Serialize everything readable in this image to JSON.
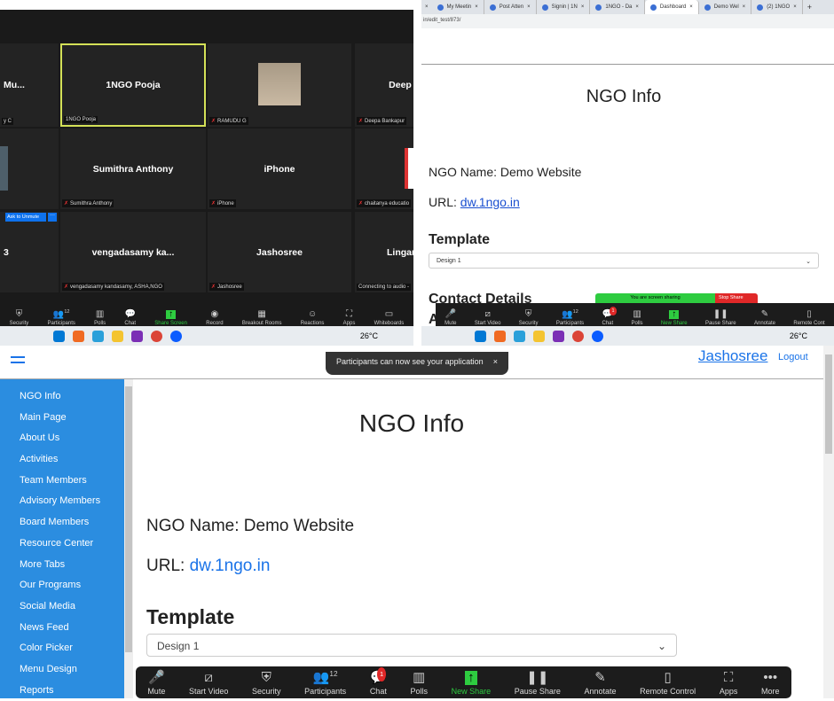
{
  "zoom_meeting": {
    "tiles": [
      {
        "name": "Mu...",
        "label": "y C",
        "muted": false
      },
      {
        "name": "1NGO Pooja",
        "label": "1NGO Pooja",
        "muted": false,
        "active_speaker": true
      },
      {
        "name": "",
        "label": "RAMUDU G",
        "muted": true,
        "has_photo": true
      },
      {
        "name": "Deep",
        "label": "Deepa Bankapur",
        "muted": true
      },
      {
        "name": "",
        "label": "",
        "muted": false
      },
      {
        "name": "Sumithra Anthony",
        "label": "Sumithra Anthony",
        "muted": true
      },
      {
        "name": "iPhone",
        "label": "iPhone",
        "muted": true
      },
      {
        "name": "",
        "label": "chaitanya educatio",
        "muted": true
      },
      {
        "name": "3",
        "label": "",
        "muted": false
      },
      {
        "name": "vengadasamy  ka...",
        "label": "vengadasamy kandasamy, ASHA,NGO",
        "muted": true
      },
      {
        "name": "Jashosree",
        "label": "Jashosree",
        "muted": true
      },
      {
        "name": "Lingar",
        "label": "Connecting to audio -",
        "muted": false
      }
    ],
    "ask_to_unmute": "Ask to Unmute",
    "more_dots": "···",
    "toolbar": [
      {
        "label": "Security",
        "icon": "shield-icon"
      },
      {
        "label": "Participants",
        "icon": "participants-icon",
        "count": "12"
      },
      {
        "label": "Polls",
        "icon": "polls-icon"
      },
      {
        "label": "Chat",
        "icon": "chat-icon"
      },
      {
        "label": "Share Screen",
        "icon": "share-screen-icon"
      },
      {
        "label": "Record",
        "icon": "record-icon"
      },
      {
        "label": "Breakout Rooms",
        "icon": "breakout-icon"
      },
      {
        "label": "Reactions",
        "icon": "reactions-icon"
      },
      {
        "label": "Apps",
        "icon": "apps-icon"
      },
      {
        "label": "Whiteboards",
        "icon": "whiteboard-icon"
      }
    ]
  },
  "taskbar": {
    "weather": "26°C"
  },
  "browser": {
    "tabs": [
      {
        "label": "My Meetin"
      },
      {
        "label": "Post Atten"
      },
      {
        "label": "Signin | 1N"
      },
      {
        "label": "1NGO - Da"
      },
      {
        "label": "Dashboard",
        "active": true
      },
      {
        "label": "Demo Wel"
      },
      {
        "label": "(2) 1NGO"
      }
    ],
    "new_tab": "+",
    "url": "in/edit_test/873/",
    "page": {
      "title": "NGO Info",
      "ngo_name": "NGO Name: Demo Website",
      "url_label": "URL: ",
      "url_link": "dw.1ngo.in",
      "template_heading": "Template",
      "template_value": "Design 1",
      "contact_heading": "Contact Details",
      "cut_text": "A"
    },
    "sharing_bar": {
      "text": "You are screen sharing",
      "stop": "Stop Share"
    },
    "toolbar": [
      {
        "label": "Mute"
      },
      {
        "label": "Start Video"
      },
      {
        "label": "Security"
      },
      {
        "label": "Participants",
        "count": "12"
      },
      {
        "label": "Chat",
        "badge": "1"
      },
      {
        "label": "Polls"
      },
      {
        "label": "New Share"
      },
      {
        "label": "Pause Share"
      },
      {
        "label": "Annotate"
      },
      {
        "label": "Remote Cont"
      }
    ]
  },
  "app": {
    "toast": "Participants can now see your application",
    "toast_close": "×",
    "user": "Jashosree",
    "logout": "Logout",
    "sidebar": [
      "NGO Info",
      "Main Page",
      "About Us",
      "Activities",
      "Team Members",
      "Advisory Members",
      "Board Members",
      "Resource Center",
      "More Tabs",
      "Our Programs",
      "Social Media",
      "News Feed",
      "Color Picker",
      "Menu Design",
      "Reports"
    ],
    "title": "NGO Info",
    "ngo_name": "NGO Name: Demo Website",
    "url_label": "URL: ",
    "url_link": "dw.1ngo.in",
    "template_heading": "Template",
    "template_value": "Design 1",
    "toolbar": [
      {
        "label": "Mute",
        "icon": "microphone-icon"
      },
      {
        "label": "Start Video",
        "icon": "video-off-icon"
      },
      {
        "label": "Security",
        "icon": "shield-icon"
      },
      {
        "label": "Participants",
        "icon": "participants-icon",
        "count": "12"
      },
      {
        "label": "Chat",
        "icon": "chat-icon",
        "badge": "1"
      },
      {
        "label": "Polls",
        "icon": "polls-icon"
      },
      {
        "label": "New Share",
        "icon": "share-icon"
      },
      {
        "label": "Pause Share",
        "icon": "pause-icon"
      },
      {
        "label": "Annotate",
        "icon": "pencil-icon"
      },
      {
        "label": "Remote Control",
        "icon": "mouse-icon"
      },
      {
        "label": "Apps",
        "icon": "apps-icon"
      },
      {
        "label": "More",
        "icon": "more-icon"
      }
    ],
    "colors": {
      "sidebar": "#2b8de0",
      "link": "#1a73e8",
      "share_green": "#2ecc40",
      "stop_red": "#e02828",
      "speaker_border": "#d4e157"
    }
  }
}
